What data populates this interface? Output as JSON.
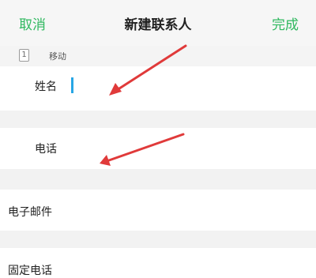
{
  "navbar": {
    "cancel_label": "取消",
    "title": "新建联系人",
    "done_label": "完成"
  },
  "account": {
    "icon_glyph": "1",
    "label": "移动"
  },
  "fields": {
    "name_label": "姓名",
    "phone_label": "电话",
    "email_label": "电子邮件",
    "landline_label": "固定电话"
  },
  "colors": {
    "accent": "#2fb85f",
    "cursor": "#27a6e5",
    "annotation_arrow": "#e03a3a"
  }
}
